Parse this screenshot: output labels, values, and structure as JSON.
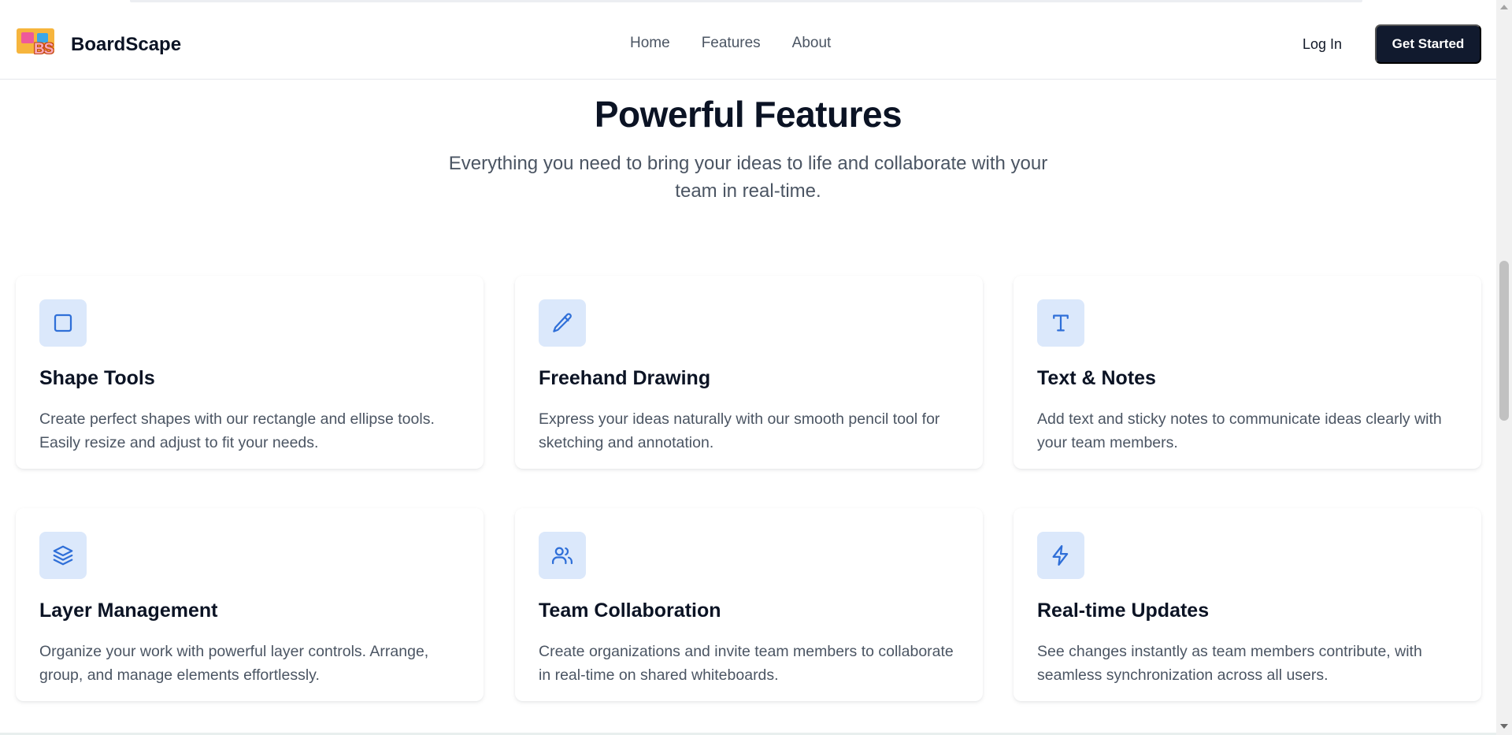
{
  "brand": {
    "name": "BoardScape",
    "logo_text": "BS"
  },
  "nav": {
    "links": [
      "Home",
      "Features",
      "About"
    ],
    "login": "Log In",
    "cta": "Get Started"
  },
  "hero": {
    "title": "Powerful Features",
    "subtitle": "Everything you need to bring your ideas to life and collaborate with your team in real-time."
  },
  "features": [
    {
      "icon": "square-icon",
      "title": "Shape Tools",
      "description": "Create perfect shapes with our rectangle and ellipse tools. Easily resize and adjust to fit your needs."
    },
    {
      "icon": "pencil-icon",
      "title": "Freehand Drawing",
      "description": "Express your ideas naturally with our smooth pencil tool for sketching and annotation."
    },
    {
      "icon": "text-icon",
      "title": "Text & Notes",
      "description": "Add text and sticky notes to communicate ideas clearly with your team members."
    },
    {
      "icon": "layers-icon",
      "title": "Layer Management",
      "description": "Organize your work with powerful layer controls. Arrange, group, and manage elements effortlessly."
    },
    {
      "icon": "users-icon",
      "title": "Team Collaboration",
      "description": "Create organizations and invite team members to collaborate in real-time on shared whiteboards."
    },
    {
      "icon": "lightning-icon",
      "title": "Real-time Updates",
      "description": "See changes instantly as team members contribute, with seamless synchronization across all users."
    }
  ],
  "colors": {
    "accent": "#2f6fd8",
    "icon_bg": "#dbe8fb",
    "cta_bg": "#111a2e",
    "text_primary": "#0b1324",
    "text_muted": "#4b5563"
  }
}
